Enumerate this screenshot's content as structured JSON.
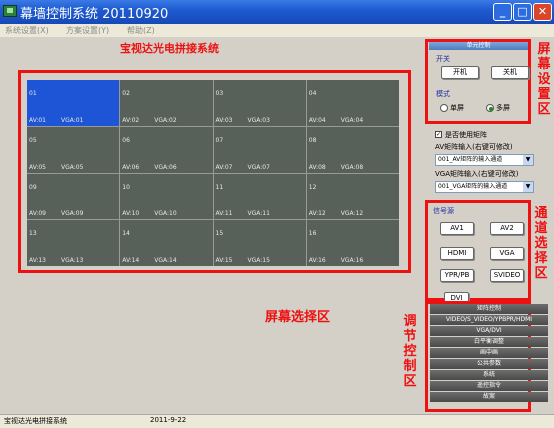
{
  "window": {
    "title": "幕墙控制系统 20110920"
  },
  "menu": [
    "系统设置(X)",
    "方案设置(Y)",
    "帮助(Z)"
  ],
  "annotations": {
    "heading": "宝视达光电拼接系统",
    "screen_area": "屏幕选择区",
    "screen_settings": "屏幕设置区",
    "channel_select": "通道选择区",
    "adjust_control": "调节控制区"
  },
  "grid": {
    "selected_index": 0,
    "cells": [
      {
        "num": "01",
        "av": "AV:01",
        "vga": "VGA:01"
      },
      {
        "num": "02",
        "av": "AV:02",
        "vga": "VGA:02"
      },
      {
        "num": "03",
        "av": "AV:03",
        "vga": "VGA:03"
      },
      {
        "num": "04",
        "av": "AV:04",
        "vga": "VGA:04"
      },
      {
        "num": "05",
        "av": "AV:05",
        "vga": "VGA:05"
      },
      {
        "num": "06",
        "av": "AV:06",
        "vga": "VGA:06"
      },
      {
        "num": "07",
        "av": "AV:07",
        "vga": "VGA:07"
      },
      {
        "num": "08",
        "av": "AV:08",
        "vga": "VGA:08"
      },
      {
        "num": "09",
        "av": "AV:09",
        "vga": "VGA:09"
      },
      {
        "num": "10",
        "av": "AV:10",
        "vga": "VGA:10"
      },
      {
        "num": "11",
        "av": "AV:11",
        "vga": "VGA:11"
      },
      {
        "num": "12",
        "av": "AV:12",
        "vga": "VGA:12"
      },
      {
        "num": "13",
        "av": "AV:13",
        "vga": "VGA:13"
      },
      {
        "num": "14",
        "av": "AV:14",
        "vga": "VGA:14"
      },
      {
        "num": "15",
        "av": "AV:15",
        "vga": "VGA:15"
      },
      {
        "num": "16",
        "av": "AV:16",
        "vga": "VGA:16"
      }
    ]
  },
  "unit_control": {
    "title": "单元控制",
    "switch_label": "开关",
    "on_button": "开机",
    "off_button": "关机",
    "mode_label": "模式",
    "single_screen": "单屏",
    "multi_screen": "多屏",
    "mode_selected": "multi"
  },
  "matrix": {
    "use_matrix_label": "是否使用矩阵",
    "use_matrix_checked": true,
    "av_input_label": "AV矩阵输入(右键可修改)",
    "av_input_value": "001_AV矩阵的输入通道",
    "vga_input_label": "VGA矩阵输入(右键可修改)",
    "vga_input_value": "001_VGA矩阵的输入通道"
  },
  "signal_source": {
    "label": "信号源",
    "buttons": [
      "AV1",
      "AV2",
      "HDMI",
      "VGA",
      "YPR/PB",
      "SVIDEO",
      "DVI"
    ]
  },
  "accordion": [
    "矩阵控制",
    "VIDEO/S_VIDEO/YPBPR/HDMI",
    "VGA/DVI",
    "白平衡调整",
    "画中画",
    "公共参数",
    "系统",
    "遥控指令",
    "故案"
  ],
  "status": {
    "app_name": "宝视达光电拼接系统",
    "date": "2011-9-22"
  },
  "colors": {
    "title_bar": "#1e5bd1",
    "selected_cell": "#1e55d6",
    "cell": "#58605a",
    "annotation": "#ee1111"
  }
}
